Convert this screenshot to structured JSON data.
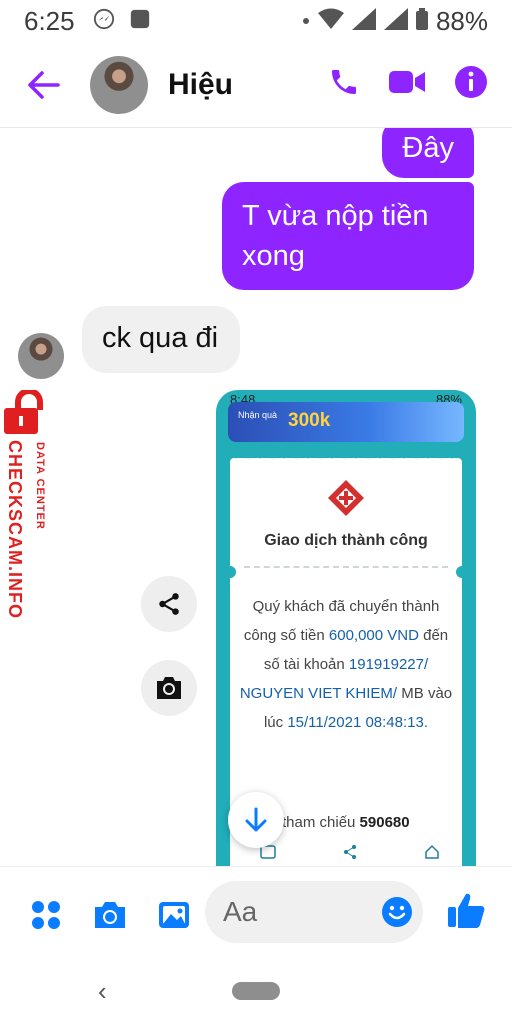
{
  "status_bar": {
    "time": "6:25",
    "battery": "88%"
  },
  "header": {
    "contact_name": "Hiệu"
  },
  "messages": {
    "outgoing": [
      "Đây",
      "T vừa nộp tiền xong"
    ],
    "incoming": [
      "ck qua đi"
    ]
  },
  "shared_screenshot": {
    "status_time": "8:48",
    "status_battery": "88%",
    "banner_small": "Nhận quà",
    "banner_big": "300k",
    "title": "Giao dịch thành công",
    "body_1": "Quý khách đã chuyển thành công số tiền",
    "amount": "600,000 VND",
    "body_2": "đến số tài khoản",
    "account": "191919227/",
    "recipient": "NGUYEN VIET KHIEM/",
    "bank_prefix": "MB vào lúc",
    "datetime": "15/11/2021 08:48:13.",
    "ref_label": "tham chiếu",
    "ref_number": "590680"
  },
  "watermark": {
    "brand": "CHECKSCAM.INFO",
    "tag": "DATA CENTER"
  },
  "composer": {
    "placeholder": "Aa"
  },
  "colors": {
    "accent": "#8e24ff",
    "messenger_blue": "#0a7cff",
    "watermark_red": "#e02020"
  }
}
